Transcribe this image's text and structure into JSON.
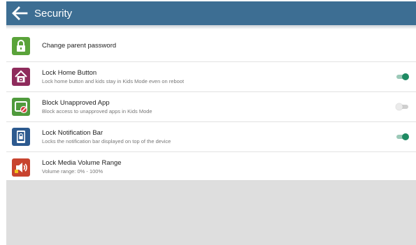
{
  "header": {
    "title": "Security",
    "back_icon": "arrow-left-icon",
    "background": "#3d6e93"
  },
  "settings": [
    {
      "title": "Change parent password",
      "subtitle": "",
      "icon": "lock-icon",
      "icon_color": "#5aa33a"
    },
    {
      "title": "Lock Home Button",
      "subtitle": "Lock home button and kids stay in Kids Mode even on reboot",
      "icon": "home-lock-icon",
      "icon_color": "#8e2b5c",
      "toggle": true
    },
    {
      "title": "Block Unapproved App",
      "subtitle": "Block access to unapproved apps in Kids Mode",
      "icon": "block-app-icon",
      "icon_color": "#4f9a3c",
      "toggle": false
    },
    {
      "title": "Lock Notification Bar",
      "subtitle": "Locks the notification bar displayed on top of the device",
      "icon": "notification-lock-icon",
      "icon_color": "#2d5a8f",
      "toggle": true
    },
    {
      "title": "Lock Media Volume Range",
      "subtitle": "Volume range: 0% - 100%",
      "icon": "volume-lock-icon",
      "icon_color": "#c8432e"
    }
  ],
  "colors": {
    "toggle_on": "#1e8a63",
    "toggle_off": "#ebebeb"
  }
}
